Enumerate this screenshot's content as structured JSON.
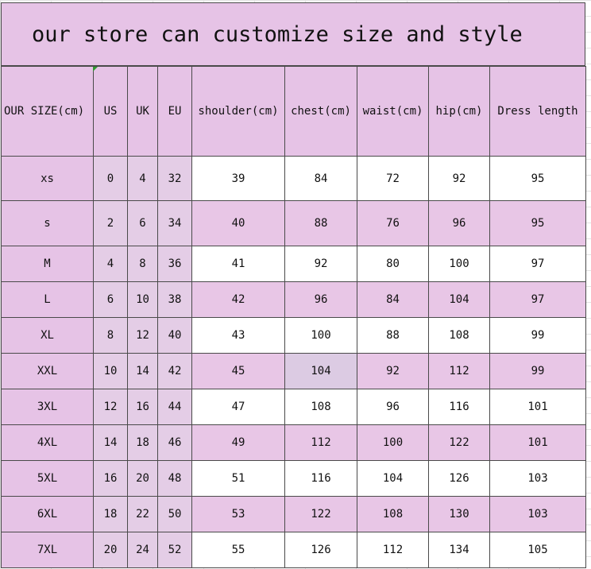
{
  "title": "our store can customize size and style",
  "headers": [
    "OUR SIZE(cm)",
    "US",
    "UK",
    "EU",
    "shoulder(cm)",
    "chest(cm)",
    "waist(cm)",
    "hip(cm)",
    "Dress length"
  ],
  "rows": [
    [
      "xs",
      "0",
      "4",
      "32",
      "39",
      "84",
      "72",
      "92",
      "95"
    ],
    [
      "s",
      "2",
      "6",
      "34",
      "40",
      "88",
      "76",
      "96",
      "95"
    ],
    [
      "M",
      "4",
      "8",
      "36",
      "41",
      "92",
      "80",
      "100",
      "97"
    ],
    [
      "L",
      "6",
      "10",
      "38",
      "42",
      "96",
      "84",
      "104",
      "97"
    ],
    [
      "XL",
      "8",
      "12",
      "40",
      "43",
      "100",
      "88",
      "108",
      "99"
    ],
    [
      "XXL",
      "10",
      "14",
      "42",
      "45",
      "104",
      "92",
      "112",
      "99"
    ],
    [
      "3XL",
      "12",
      "16",
      "44",
      "47",
      "108",
      "96",
      "116",
      "101"
    ],
    [
      "4XL",
      "14",
      "18",
      "46",
      "49",
      "112",
      "100",
      "122",
      "101"
    ],
    [
      "5XL",
      "16",
      "20",
      "48",
      "51",
      "116",
      "104",
      "126",
      "103"
    ],
    [
      "6XL",
      "18",
      "22",
      "50",
      "53",
      "122",
      "108",
      "130",
      "103"
    ],
    [
      "7XL",
      "20",
      "24",
      "52",
      "55",
      "126",
      "112",
      "134",
      "105"
    ]
  ],
  "colors": {
    "header_pink": "#e6c3e6",
    "row_pink": "#e8c6e6",
    "us_uk_eu_lavender": "#e4cde6",
    "white": "#ffffff",
    "border": "#4a4a4a",
    "selection_marker": "#2f9a2f"
  }
}
